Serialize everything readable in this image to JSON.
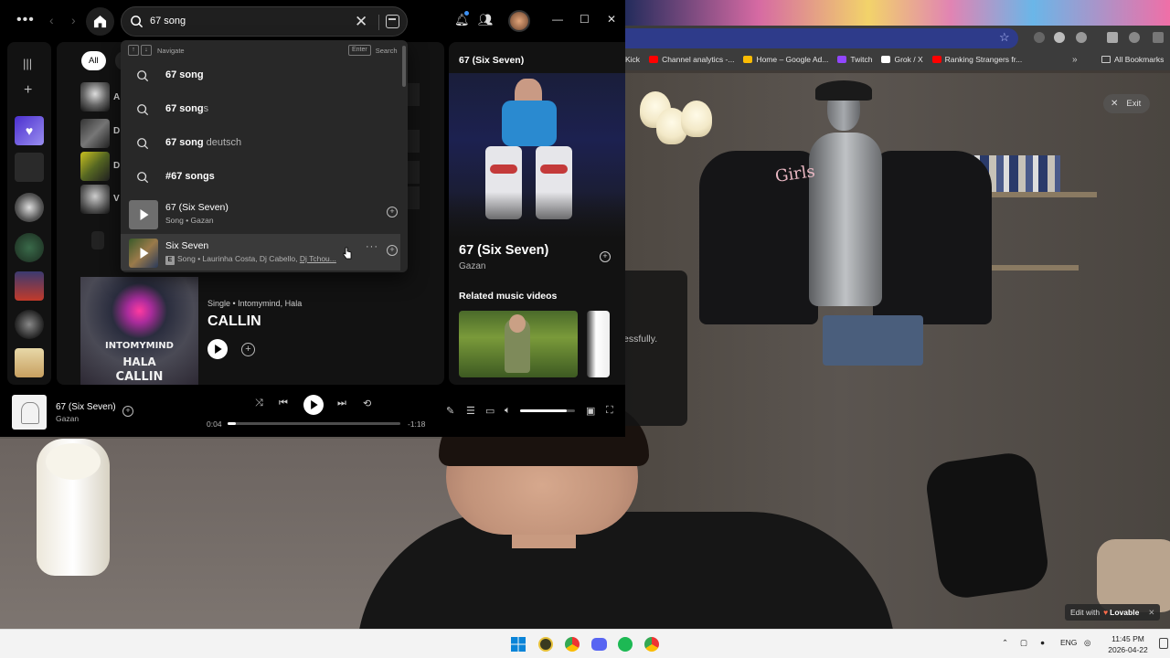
{
  "search": {
    "value": "67 song",
    "hint_navigate": "Navigate",
    "hint_enter": "Enter",
    "hint_search": "Search"
  },
  "suggestions": [
    {
      "bold": "67 song",
      "rest": ""
    },
    {
      "bold": "67 song",
      "rest": "s"
    },
    {
      "bold": "67 song",
      "rest": " deutsch"
    },
    {
      "bold": "#67 songs",
      "rest": ""
    }
  ],
  "track_results": [
    {
      "title": "67 (Six Seven)",
      "subtitle": "Song • Gazan"
    },
    {
      "title": "Six Seven",
      "explicit": "E",
      "subtitle_prefix": "Song • Laurinha Costa, Dj Cabello, ",
      "subtitle_link": "Dj Tchou..."
    }
  ],
  "main": {
    "chip_all": "All",
    "result_letters": [
      "A",
      "D",
      "D",
      "V"
    ],
    "single_meta": "Single • Intomymind, Hala",
    "single_title": "CALLIN",
    "cover_text": [
      "INTOMYMIND",
      "HALA",
      "CALLIN"
    ]
  },
  "now_playing_panel": {
    "header": "67 (Six Seven)",
    "song": "67 (Six Seven)",
    "artist": "Gazan",
    "related_heading": "Related music videos"
  },
  "player": {
    "title": "67 (Six Seven)",
    "artist": "Gazan",
    "elapsed": "0:04",
    "remaining": "-1:18",
    "progress": 0.05,
    "volume": 0.85
  },
  "browser": {
    "bookmarks": [
      {
        "label": "Kick",
        "color": ""
      },
      {
        "label": "Channel analytics -...",
        "color": "#ff0000"
      },
      {
        "label": "Home – Google Ad...",
        "color": "#fbbc04"
      },
      {
        "label": "Twitch",
        "color": "#9146ff"
      },
      {
        "label": "Grok / X",
        "color": "#ffffff"
      },
      {
        "label": "Ranking Strangers fr...",
        "color": "#ff0000"
      }
    ],
    "all_bookmarks": "All Bookmarks",
    "more": "»"
  },
  "overlay": {
    "exit": "Exit",
    "fragment_text": "essfully.",
    "lovable_prefix": "Edit with",
    "lovable_brand": "Lovable",
    "jacket_text": "Girls"
  },
  "taskbar": {
    "lang": "ENG",
    "time": "11:45 PM",
    "date": "2026-04-22"
  },
  "colors": {
    "spotify_green": "#1db954",
    "panel_bg": "#121212",
    "dropdown_bg": "#282828"
  }
}
